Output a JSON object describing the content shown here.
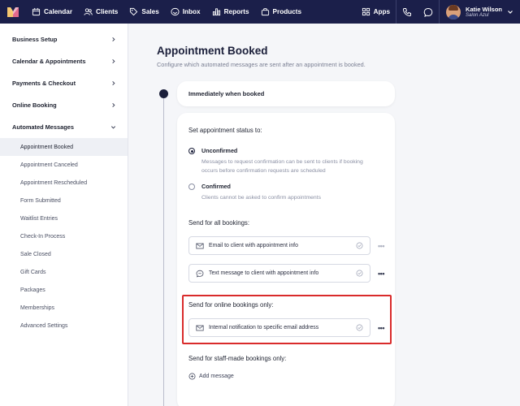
{
  "nav": {
    "items": [
      "Calendar",
      "Clients",
      "Sales",
      "Inbox",
      "Reports",
      "Products"
    ],
    "apps_label": "Apps",
    "user_name": "Katie Wilson",
    "user_location": "Salon Azul"
  },
  "sidebar": {
    "sections": [
      "Business Setup",
      "Calendar & Appointments",
      "Payments & Checkout",
      "Online Booking",
      "Automated Messages"
    ],
    "subitems": [
      "Appointment Booked",
      "Appointment Canceled",
      "Appointment Rescheduled",
      "Form Submitted",
      "Waitlist Entries",
      "Check-In Process",
      "Sale Closed",
      "Gift Cards",
      "Packages",
      "Memberships",
      "Advanced Settings"
    ],
    "active_subitem": "Appointment Booked"
  },
  "main": {
    "title": "Appointment Booked",
    "description": "Configure which automated messages are sent after an appointment is booked.",
    "trigger": "Immediately when booked",
    "status_label": "Set appointment status to:",
    "options": [
      {
        "title": "Unconfirmed",
        "desc": "Messages to request confirmation can be sent to clients if booking occurs before confirmation requests are scheduled",
        "checked": true
      },
      {
        "title": "Confirmed",
        "desc": "Clients cannot be asked to confirm appointments",
        "checked": false
      }
    ],
    "all_bookings_label": "Send for all bookings:",
    "all_messages": [
      "Email to client with appointment info",
      "Text message to client with appointment info"
    ],
    "online_label": "Send for online bookings only:",
    "online_messages": [
      "Internal notification to specific email address"
    ],
    "staff_label": "Send for staff-made bookings only:",
    "add_message": "Add message"
  },
  "colors": {
    "nav_bg": "#1b1f4a",
    "highlight": "#d92b2b"
  }
}
